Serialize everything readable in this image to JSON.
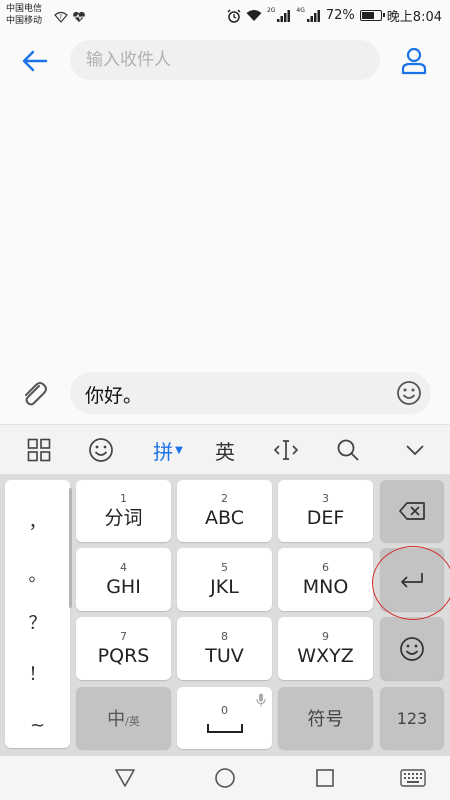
{
  "status_bar": {
    "carrier_1": "中国电信",
    "carrier_2": "中国移动",
    "signal_1_label": "2G",
    "signal_2_label": "4G",
    "battery": "72%",
    "battery_level": 0.72,
    "time": "晚上8:04"
  },
  "header": {
    "recipient_placeholder": "输入收件人",
    "recipient_value": ""
  },
  "compose": {
    "message_text": "你好。"
  },
  "ime_toolbar": {
    "pinyin_label": "拼",
    "english_label": "英"
  },
  "keyboard": {
    "punctuation": [
      "，",
      "。",
      "？",
      "！",
      "~"
    ],
    "keys": {
      "k1": {
        "num": "1",
        "label": "分词"
      },
      "k2": {
        "num": "2",
        "label": "ABC"
      },
      "k3": {
        "num": "3",
        "label": "DEF"
      },
      "k4": {
        "num": "4",
        "label": "GHI"
      },
      "k5": {
        "num": "5",
        "label": "JKL"
      },
      "k6": {
        "num": "6",
        "label": "MNO"
      },
      "k7": {
        "num": "7",
        "label": "PQRS"
      },
      "k8": {
        "num": "8",
        "label": "TUV"
      },
      "k9": {
        "num": "9",
        "label": "WXYZ"
      },
      "k0": {
        "num": "0"
      }
    },
    "zh_en_main": "中",
    "zh_en_sub": "/英",
    "symbols_label": "符号",
    "number_mode_label": "123"
  },
  "colors": {
    "accent": "#1a73e8",
    "highlight": "#d32f2f"
  }
}
